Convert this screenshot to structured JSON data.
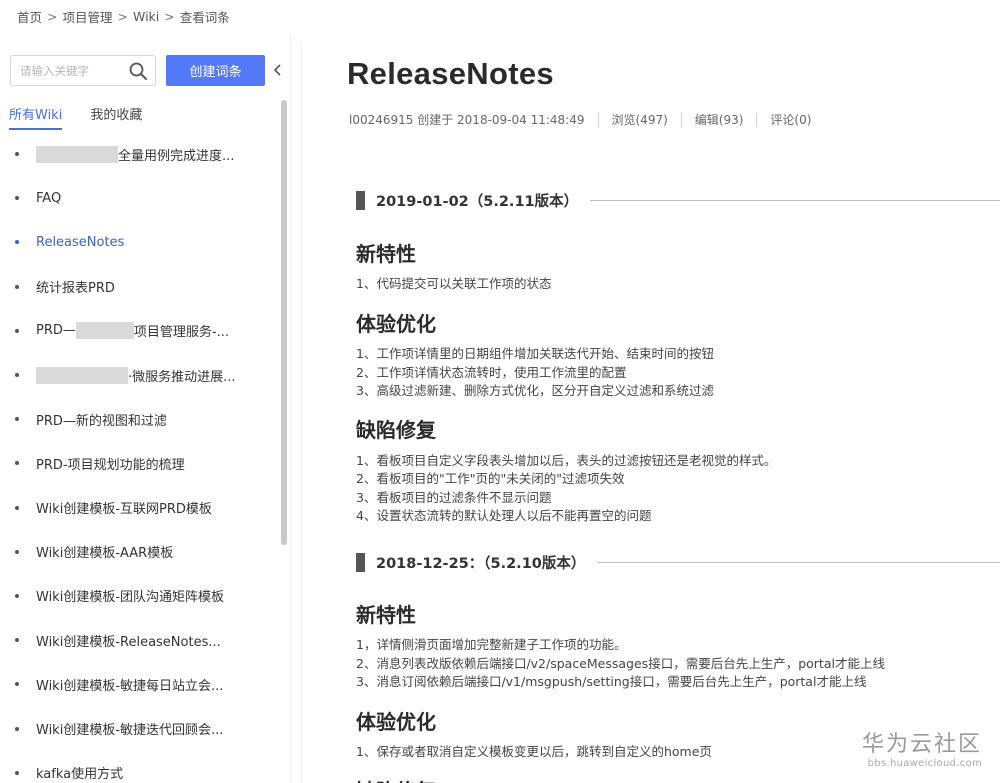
{
  "breadcrumb": [
    "首页",
    "项目管理",
    "Wiki",
    "查看词条"
  ],
  "breadcrumb_sep": ">",
  "sidebar": {
    "search_placeholder": "请输入关键字",
    "create_label": "创建词条",
    "tabs": [
      {
        "label": "所有Wiki",
        "active": true
      },
      {
        "label": "我的收藏",
        "active": false
      }
    ],
    "items": [
      {
        "label": "全量用例完成进度...",
        "redacted_before": true
      },
      {
        "label": "FAQ"
      },
      {
        "label": "ReleaseNotes",
        "active": true
      },
      {
        "label": "统计报表PRD"
      },
      {
        "label_prefix": "PRD—",
        "label": "项目管理服务-...",
        "redacted_middle": true
      },
      {
        "label": "·微服务推动进展...",
        "redacted_before": true
      },
      {
        "label": "PRD—新的视图和过滤"
      },
      {
        "label": "PRD-项目规划功能的梳理"
      },
      {
        "label": "Wiki创建模板-互联网PRD模板"
      },
      {
        "label": "Wiki创建模板-AAR模板"
      },
      {
        "label": "Wiki创建模板-团队沟通矩阵模板"
      },
      {
        "label": "Wiki创建模板-ReleaseNotes..."
      },
      {
        "label": "Wiki创建模板-敏捷每日站立会..."
      },
      {
        "label": "Wiki创建模板-敏捷迭代回顾会..."
      },
      {
        "label": "kafka使用方式"
      }
    ]
  },
  "article": {
    "title": "ReleaseNotes",
    "meta": {
      "author_created": "l00246915 创建于 2018-09-04 11:48:49",
      "views": "浏览(497)",
      "edits": "编辑(93)",
      "comments": "评论(0)"
    },
    "sections": [
      {
        "heading": "2019-01-02（5.2.11版本）",
        "groups": [
          {
            "title": "新特性",
            "items": [
              "1、代码提交可以关联工作项的状态"
            ]
          },
          {
            "title": "体验优化",
            "items": [
              "1、工作项详情里的日期组件增加关联迭代开始、结束时间的按钮",
              "2、工作项详情状态流转时，使用工作流里的配置",
              "3、高级过滤新建、删除方式优化，区分开自定义过滤和系统过滤"
            ]
          },
          {
            "title": "缺陷修复",
            "items": [
              "1、看板项目自定义字段表头增加以后，表头的过滤按钮还是老视觉的样式。",
              "2、看板项目的\"工作\"页的\"未关闭的\"过滤项失效",
              "3、看板项目的过滤条件不显示问题",
              "4、设置状态流转的默认处理人以后不能再置空的问题"
            ]
          }
        ]
      },
      {
        "heading": "2018-12-25：（5.2.10版本）",
        "groups": [
          {
            "title": "新特性",
            "items": [
              "1，详情侧滑页面增加完整新建子工作项的功能。",
              "2、消息列表改版依赖后端接口/v2/spaceMessages接口，需要后台先上生产，portal才能上线",
              "3、消息订阅依赖后端接口/v1/msgpush/setting接口，需要后台先上生产，portal才能上线"
            ]
          },
          {
            "title": "体验优化",
            "items": [
              "1、保存或者取消自定义模板变更以后，跳转到自定义的home页"
            ]
          },
          {
            "title": "缺陷修复",
            "items": []
          }
        ]
      }
    ]
  },
  "watermark": {
    "main": "华为云社区",
    "sub": "bbs.huaweicloud.com"
  },
  "colors": {
    "accent": "#5479f7",
    "active_link": "#3d5fcf",
    "text": "#333333"
  },
  "icons": {
    "search": "search-icon",
    "collapse": "chevron-left-icon"
  }
}
